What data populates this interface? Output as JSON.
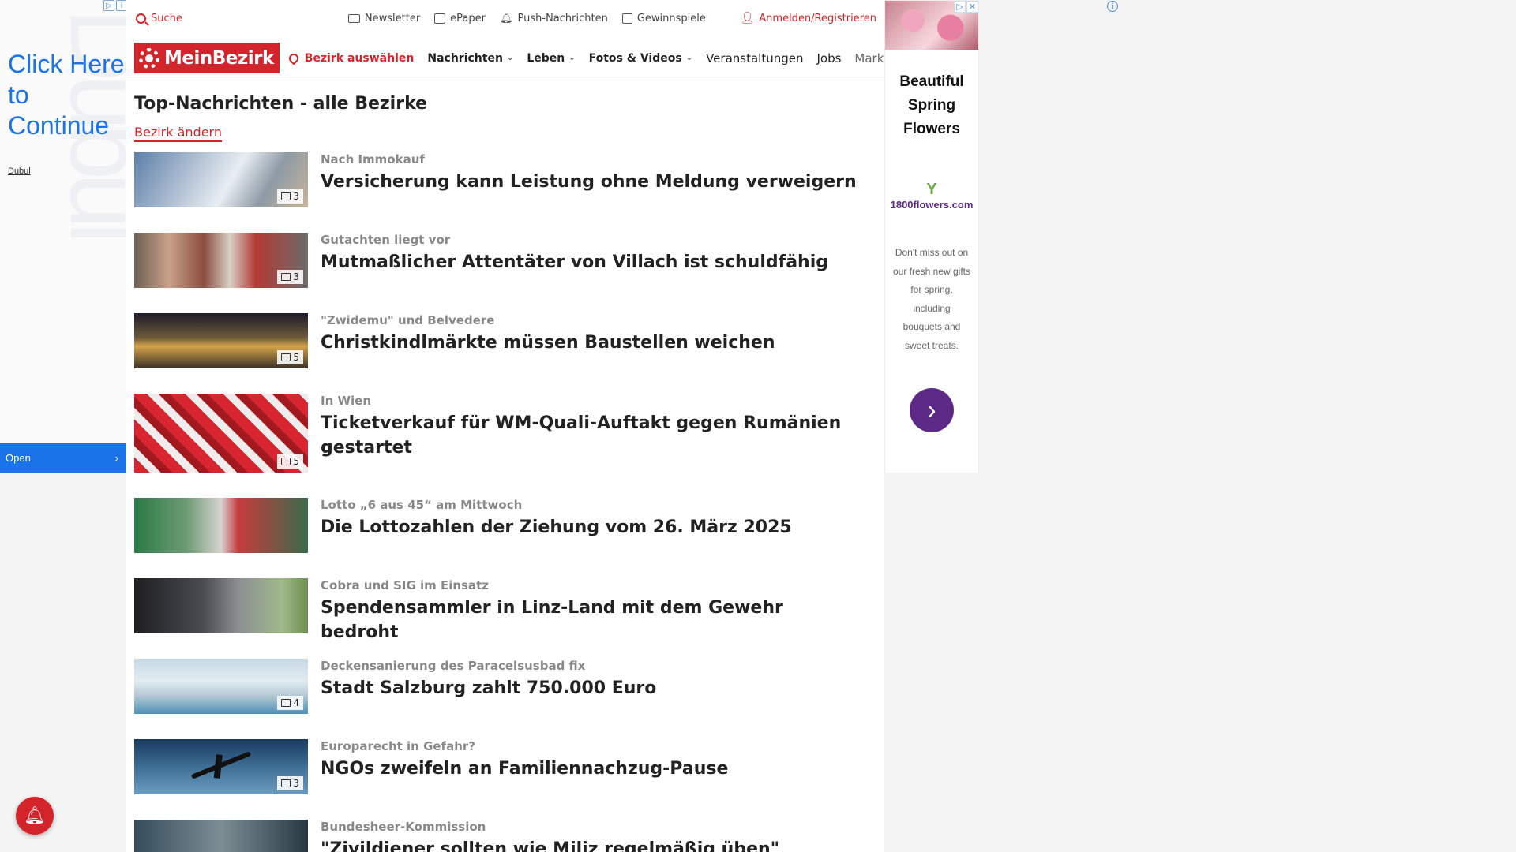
{
  "left_ad": {
    "click_text": "Click Here to Continue",
    "brand": "Dubul",
    "open_label": "Open"
  },
  "topbar": {
    "search_label": "Suche",
    "newsletter_label": "Newsletter",
    "epaper_label": "ePaper",
    "push_label": "Push-Nachrichten",
    "gewinnspiele_label": "Gewinnspiele",
    "login_label": "Anmelden/Registrieren"
  },
  "nav": {
    "logo_text": "MeinBezirk",
    "district_label": "Bezirk auswählen",
    "links": [
      {
        "label": "Nachrichten",
        "dropdown": true
      },
      {
        "label": "Leben",
        "dropdown": true
      },
      {
        "label": "Fotos & Videos",
        "dropdown": true
      },
      {
        "label": "Veranstaltungen",
        "dropdown": false
      },
      {
        "label": "Jobs",
        "dropdown": false
      },
      {
        "label": "Marktplatz",
        "dropdown": false
      }
    ]
  },
  "section": {
    "title": "Top-Nachrichten - alle Bezirke",
    "change_link": "Bezirk ändern"
  },
  "articles": [
    {
      "kicker": "Nach Immokauf",
      "headline": "Versicherung kann Leistung ohne Meldung verweigern",
      "photo_count": "3"
    },
    {
      "kicker": "Gutachten liegt vor",
      "headline": "Mutmaßlicher Attentäter von Villach ist schuldfähig",
      "photo_count": "3"
    },
    {
      "kicker": "\"Zwidemu\" und Belvedere",
      "headline": "Christkindlmärkte müssen Baustellen weichen",
      "photo_count": "5"
    },
    {
      "kicker": "In Wien",
      "headline": "Ticketverkauf für WM-Quali-Auftakt gegen Rumänien gestartet",
      "photo_count": "5"
    },
    {
      "kicker": "Lotto „6 aus 45“ am Mittwoch",
      "headline": "Die Lottozahlen der Ziehung vom 26. März 2025",
      "photo_count": ""
    },
    {
      "kicker": "Cobra und SIG im Einsatz",
      "headline": "Spendensammler in Linz-Land mit dem Gewehr bedroht",
      "photo_count": ""
    },
    {
      "kicker": "Deckensanierung des Paracelsusbad fix",
      "headline": "Stadt Salzburg zahlt 750.000 Euro",
      "photo_count": "4"
    },
    {
      "kicker": "Europarecht in Gefahr?",
      "headline": "NGOs zweifeln an Familiennachzug-Pause",
      "photo_count": "3"
    },
    {
      "kicker": "Bundesheer-Kommission",
      "headline": "\"Zivildiener sollten wie Miliz regelmäßig üben\"",
      "photo_count": ""
    }
  ],
  "right_ad": {
    "title": "Beautiful Spring Flowers",
    "logo_text": "1800flowers.com",
    "description": "Don't miss out on our fresh new gifts for spring, including bouquets and sweet treats."
  },
  "colors": {
    "brand_red": "#d3242b",
    "ad_blue": "#1a73e8",
    "ad_purple": "#5c2a86"
  }
}
